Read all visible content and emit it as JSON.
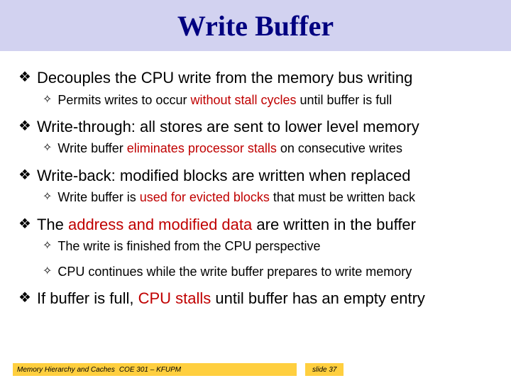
{
  "title": "Write Buffer",
  "bullets": [
    {
      "level": 1,
      "pre": "Decouples the CPU write from the memory bus writing"
    },
    {
      "level": 2,
      "pre": "Permits writes to occur ",
      "accent": "without stall cycles",
      "post": " until buffer is full"
    },
    {
      "level": 1,
      "pre": "Write-through: all stores are sent to lower level memory"
    },
    {
      "level": 2,
      "pre": "Write buffer ",
      "accent": "eliminates processor stalls",
      "post": " on consecutive writes"
    },
    {
      "level": 1,
      "pre": "Write-back: modified blocks are written when replaced"
    },
    {
      "level": 2,
      "pre": "Write buffer is ",
      "accent": "used for evicted blocks",
      "post": " that must be written back"
    },
    {
      "level": 1,
      "pre": "The ",
      "accent": "address and modified data",
      "post": " are written in the buffer"
    },
    {
      "level": 2,
      "pre": "The write is finished from the CPU perspective"
    },
    {
      "level": 2,
      "pre": "CPU continues while the write buffer prepares to write memory"
    },
    {
      "level": 1,
      "pre": "If buffer is full, ",
      "accent": "CPU stalls",
      "post": " until buffer has an empty entry"
    }
  ],
  "footer": {
    "topic": "Memory Hierarchy and Caches",
    "course": "COE 301 – KFUPM"
  },
  "slide": "slide 37",
  "glyphs": {
    "l1": "❖",
    "l2": "✧"
  }
}
